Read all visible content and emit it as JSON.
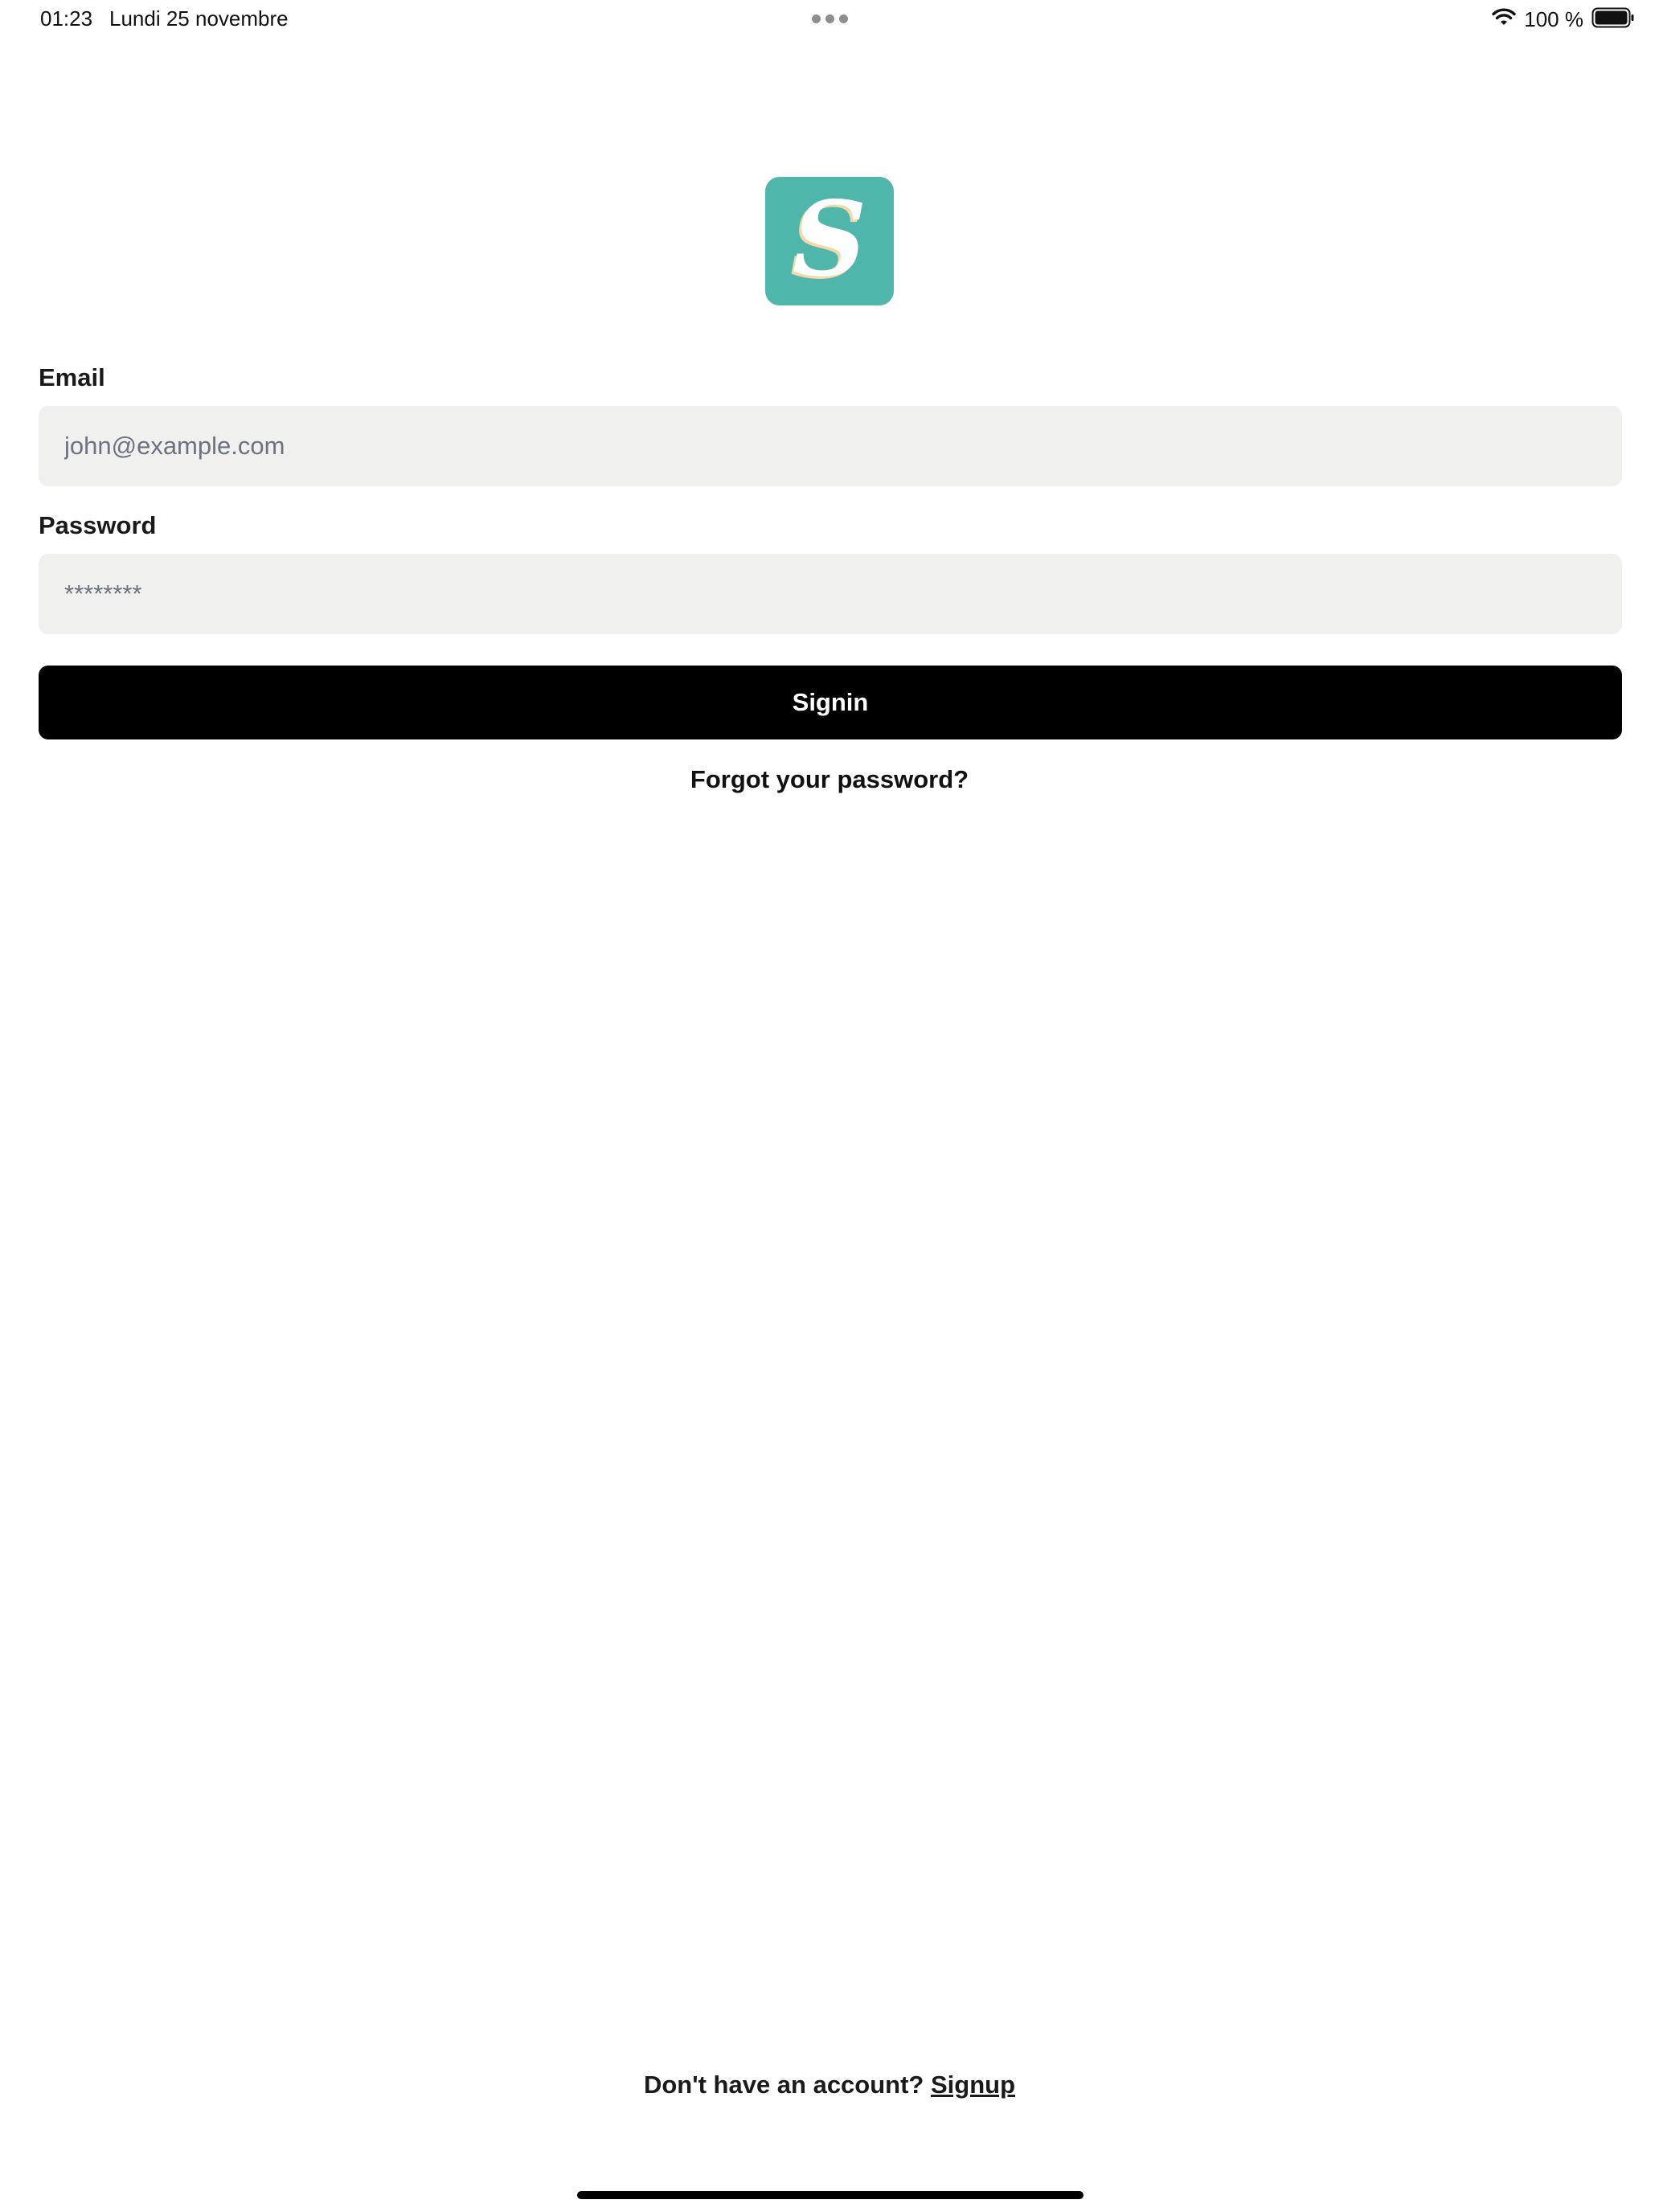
{
  "status_bar": {
    "time": "01:23",
    "date": "Lundi 25 novembre",
    "battery_percent": "100 %",
    "wifi_icon": "wifi-icon",
    "battery_icon": "battery-icon",
    "battery_level": 1.0
  },
  "logo": {
    "letter": "S",
    "background_color": "#4fb6ac"
  },
  "form": {
    "email_label": "Email",
    "email_placeholder": "john@example.com",
    "password_label": "Password",
    "password_placeholder": "********",
    "signin_label": "Signin",
    "forgot_password": "Forgot your password?"
  },
  "footer": {
    "no_account_text": "Don't have an account?",
    "signup_label": "Signup"
  },
  "colors": {
    "button_bg": "#000000",
    "input_bg": "#f0f0ee",
    "accent": "#4fb6ac"
  }
}
